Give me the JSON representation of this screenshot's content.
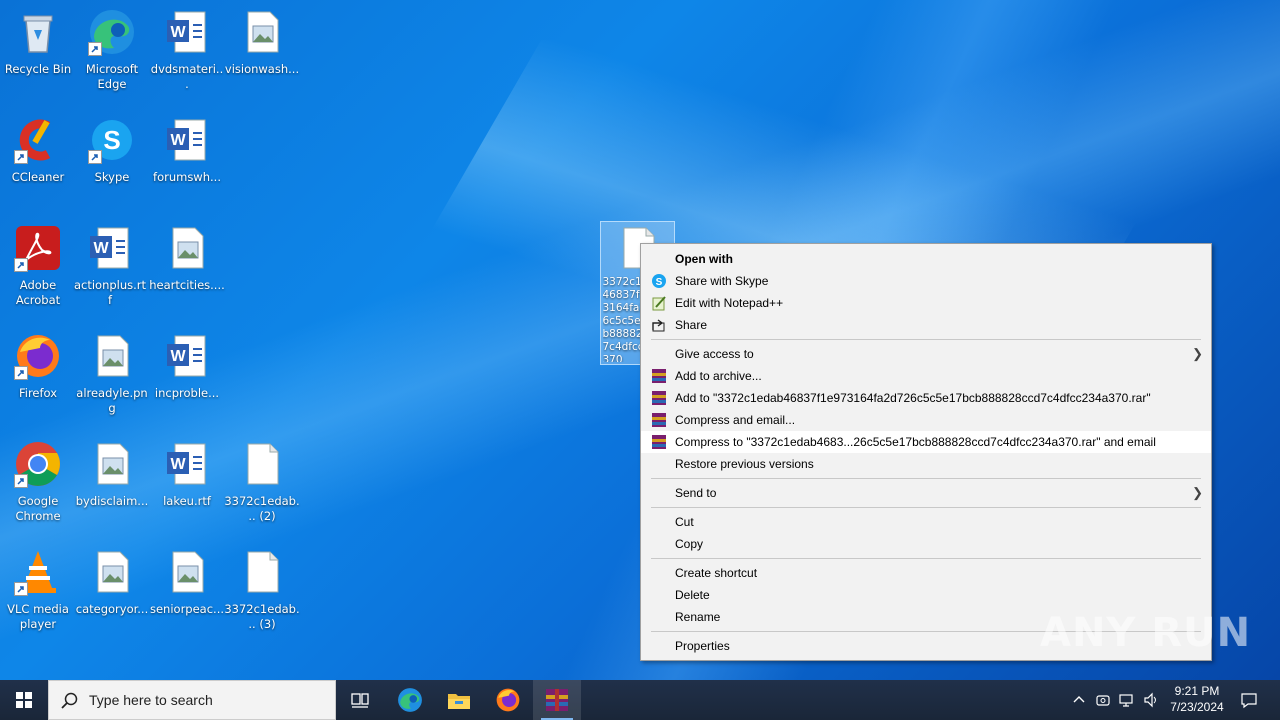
{
  "desktop": {
    "icons": [
      {
        "label": "Recycle Bin",
        "icon": "recycle-bin-icon"
      },
      {
        "label": "Microsoft Edge",
        "icon": "edge-icon"
      },
      {
        "label": "dvdsmateri...",
        "icon": "word-document-icon"
      },
      {
        "label": "visionwash...",
        "icon": "image-file-icon"
      },
      {
        "label": "CCleaner",
        "icon": "ccleaner-icon"
      },
      {
        "label": "Skype",
        "icon": "skype-icon"
      },
      {
        "label": "forumswh...",
        "icon": "word-document-icon"
      },
      {
        "label": "Adobe Acrobat",
        "icon": "acrobat-icon"
      },
      {
        "label": "actionplus.rtf",
        "icon": "word-document-icon"
      },
      {
        "label": "heartcities....",
        "icon": "image-file-icon"
      },
      {
        "label": "Firefox",
        "icon": "firefox-icon"
      },
      {
        "label": "alreadyle.png",
        "icon": "image-file-icon"
      },
      {
        "label": "incproble...",
        "icon": "word-document-icon"
      },
      {
        "label": "Google Chrome",
        "icon": "chrome-icon"
      },
      {
        "label": "bydisclaim...",
        "icon": "image-file-icon"
      },
      {
        "label": "lakeu.rtf",
        "icon": "word-document-icon"
      },
      {
        "label": "3372c1edab... (2)",
        "icon": "blank-file-icon"
      },
      {
        "label": "VLC media player",
        "icon": "vlc-icon"
      },
      {
        "label": "categoryor...",
        "icon": "image-file-icon"
      },
      {
        "label": "seniorpeac...",
        "icon": "image-file-icon"
      },
      {
        "label": "3372c1edab... (3)",
        "icon": "blank-file-icon"
      }
    ],
    "selected_file": {
      "label": "3372c1edab46837f1e973164fa2d726c5c5e17bcb888828ccd7c4dfcc234a370",
      "icon": "blank-file-icon"
    }
  },
  "context_menu": {
    "items": [
      {
        "label": "Open with"
      },
      {
        "label": "Share with Skype"
      },
      {
        "label": "Edit with Notepad++"
      },
      {
        "label": "Share"
      },
      {
        "label": "Give access to"
      },
      {
        "label": "Add to archive..."
      },
      {
        "label": "Add to \"3372c1edab46837f1e973164fa2d726c5c5e17bcb888828ccd7c4dfcc234a370.rar\""
      },
      {
        "label": "Compress and email..."
      },
      {
        "label": "Compress to \"3372c1edab4683...26c5c5e17bcb888828ccd7c4dfcc234a370.rar\" and email"
      },
      {
        "label": "Restore previous versions"
      },
      {
        "label": "Send to"
      },
      {
        "label": "Cut"
      },
      {
        "label": "Copy"
      },
      {
        "label": "Create shortcut"
      },
      {
        "label": "Delete"
      },
      {
        "label": "Rename"
      },
      {
        "label": "Properties"
      }
    ]
  },
  "taskbar": {
    "search_placeholder": "Type here to search",
    "clock_time": "9:21 PM",
    "clock_date": "7/23/2024"
  },
  "watermark": "ANY RUN",
  "colors": {
    "accent": "#0078d7",
    "taskbar": "#1d2a3a",
    "menu_bg": "#f2f2f2"
  }
}
